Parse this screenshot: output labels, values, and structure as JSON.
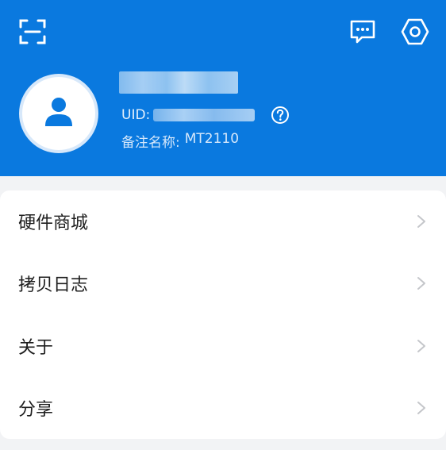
{
  "profile": {
    "uid_label": "UID:",
    "remark_label": "备注名称:",
    "remark_value": "MT2110"
  },
  "menu": {
    "items": [
      {
        "label": "硬件商城"
      },
      {
        "label": "拷贝日志"
      },
      {
        "label": "关于"
      },
      {
        "label": "分享"
      }
    ]
  },
  "colors": {
    "header_bg": "#0a79df",
    "page_bg": "#f2f3f5",
    "icon_white": "#ffffff",
    "chevron": "#c4c6ca"
  },
  "icons": [
    "scan-icon",
    "message-icon",
    "settings-icon",
    "user-icon",
    "help-icon",
    "chevron-right-icon"
  ]
}
